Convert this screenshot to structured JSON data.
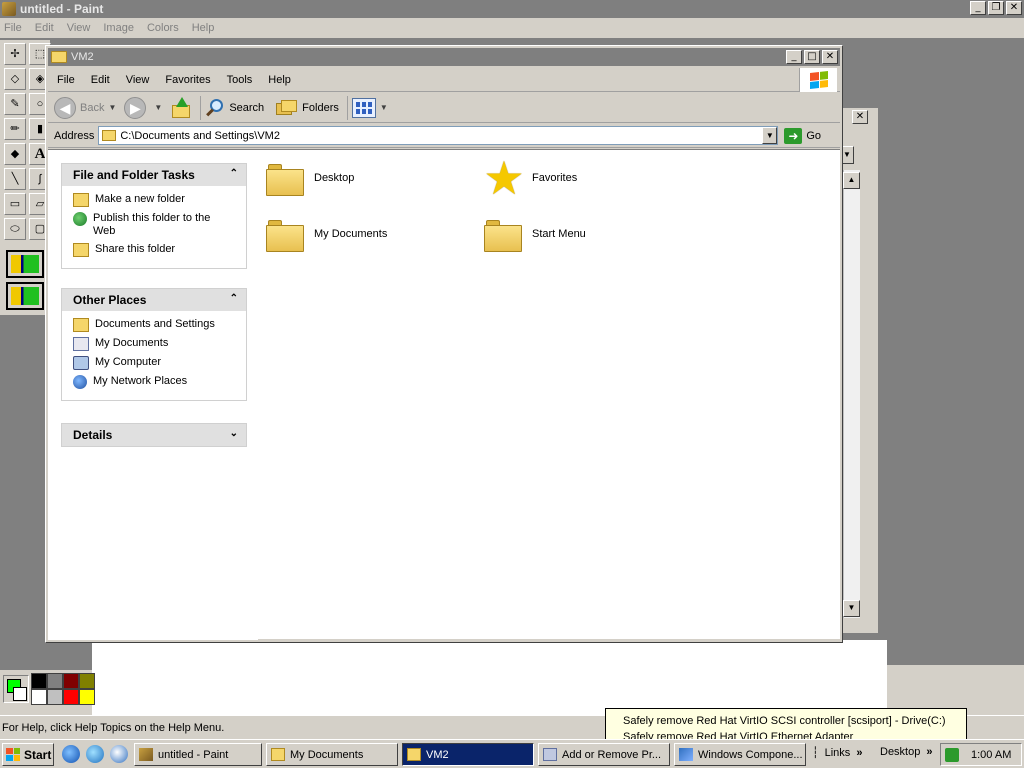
{
  "paint": {
    "title": "untitled - Paint",
    "menu": [
      "File",
      "Edit",
      "View",
      "Image",
      "Colors",
      "Help"
    ],
    "status": "For Help, click Help Topics on the Help Menu.",
    "palette": [
      "#000000",
      "#808080",
      "#800000",
      "#808000",
      "#ffffff",
      "#c0c0c0",
      "#ff0000",
      "#ffff00"
    ],
    "fg_color": "#00ff00",
    "bg_color": "#ffffff"
  },
  "explorer": {
    "title": "VM2",
    "menu": [
      "File",
      "Edit",
      "View",
      "Favorites",
      "Tools",
      "Help"
    ],
    "toolbar": {
      "back": "Back",
      "search": "Search",
      "folders": "Folders"
    },
    "address": {
      "label": "Address",
      "value": "C:\\Documents and Settings\\VM2",
      "go": "Go"
    },
    "tasks": {
      "file_folder": {
        "title": "File and Folder Tasks",
        "items": [
          "Make a new folder",
          "Publish this folder to the Web",
          "Share this folder"
        ]
      },
      "other_places": {
        "title": "Other Places",
        "items": [
          "Documents and Settings",
          "My Documents",
          "My Computer",
          "My Network Places"
        ]
      },
      "details": {
        "title": "Details"
      }
    },
    "files": [
      {
        "name": "Desktop",
        "icon": "folder-icon"
      },
      {
        "name": "Favorites",
        "icon": "star-icon"
      },
      {
        "name": "My Documents",
        "icon": "folder-icon"
      },
      {
        "name": "Start Menu",
        "icon": "folder-icon"
      }
    ]
  },
  "taskbar": {
    "start": "Start",
    "tasks": [
      {
        "label": "untitled - Paint",
        "active": false
      },
      {
        "label": "My Documents",
        "active": false
      },
      {
        "label": "VM2",
        "active": true
      },
      {
        "label": "Add or Remove Pr...",
        "active": false
      },
      {
        "label": "Windows Compone...",
        "active": false
      }
    ],
    "links": "Links",
    "desktop": "Desktop",
    "clock": "1:00 AM"
  },
  "notification": {
    "line1": "Safely remove Red Hat VirtIO SCSI controller [scsiport] - Drive(C:)",
    "line2": "Safely remove Red Hat VirtIO Ethernet Adapter"
  },
  "colors": {
    "inactive_title": "#7f7f7f",
    "task_active": "#0a246a",
    "face": "#d4d0c8"
  }
}
